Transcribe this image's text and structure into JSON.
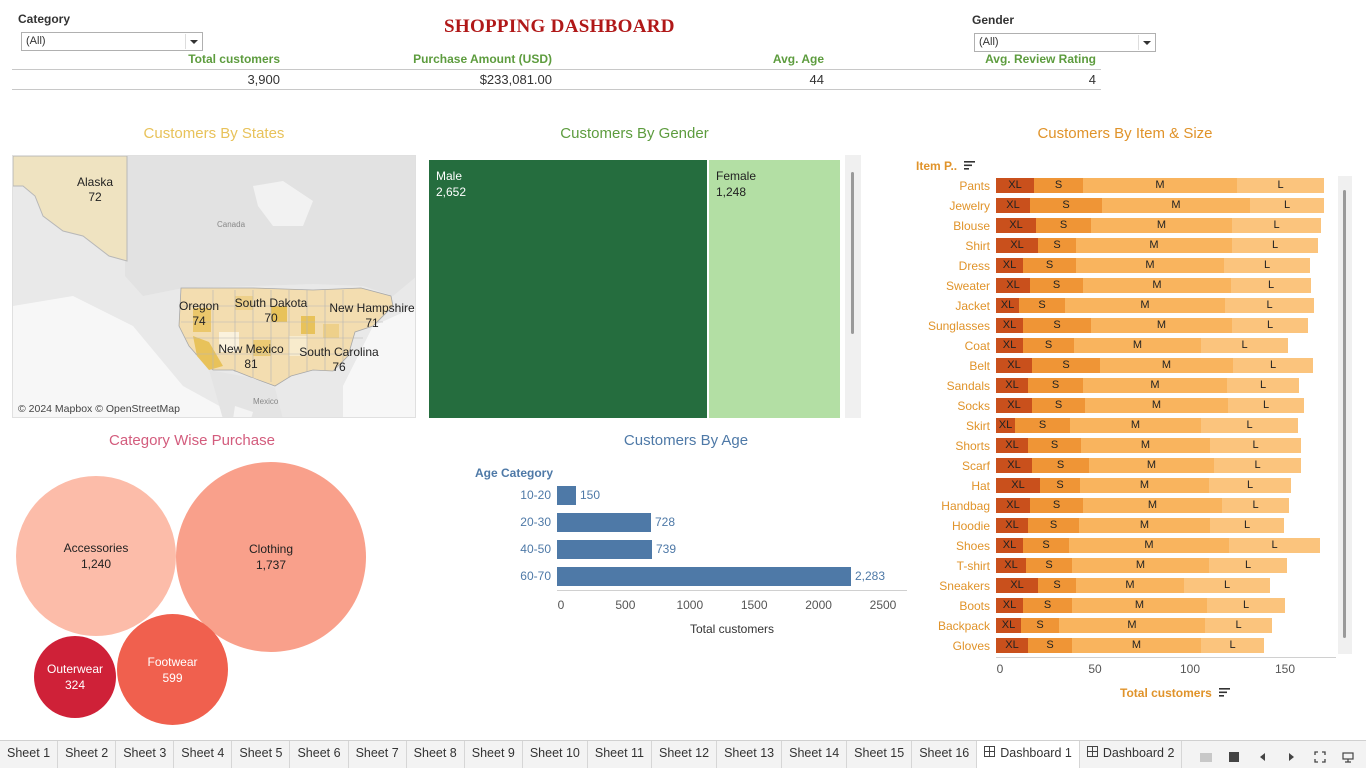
{
  "title": "SHOPPING DASHBOARD",
  "filters": {
    "category": {
      "label": "Category",
      "value": "(All)"
    },
    "gender": {
      "label": "Gender",
      "value": "(All)"
    }
  },
  "kpis": [
    {
      "label": "Total customers",
      "value": "3,900"
    },
    {
      "label": "Purchase Amount (USD)",
      "value": "$233,081.00"
    },
    {
      "label": "Avg. Age",
      "value": "44"
    },
    {
      "label": "Avg. Review Rating",
      "value": "4"
    }
  ],
  "states_map": {
    "title": "Customers By States",
    "labels": [
      {
        "state": "Alaska",
        "value": "72"
      },
      {
        "state": "Oregon",
        "value": "74"
      },
      {
        "state": "South Dakota",
        "value": "70"
      },
      {
        "state": "New Hampshire",
        "value": "71"
      },
      {
        "state": "New Mexico",
        "value": "81"
      },
      {
        "state": "South Carolina",
        "value": "76"
      }
    ],
    "place_canada": "Canada",
    "place_mexico": "Mexico",
    "attribution": "© 2024 Mapbox © OpenStreetMap"
  },
  "colors": {
    "kpi_green": "#5d9c3e",
    "title_red": "#b01818",
    "male": "#256d3e",
    "female": "#b3dfa4",
    "age_bar": "#4e79a7",
    "xl": "#c9501c",
    "s": "#ef9536",
    "m": "#f9b45e",
    "l": "#fbc47d"
  },
  "chart_data": [
    {
      "type": "treemap",
      "title": "Customers By Gender",
      "categories": [
        "Male",
        "Female"
      ],
      "values": [
        2652,
        1248
      ],
      "display": [
        "2,652",
        "1,248"
      ]
    },
    {
      "type": "bar",
      "orientation": "horizontal",
      "title": "Customers By Age",
      "ylabel": "Age Category",
      "xlabel": "Total customers",
      "categories": [
        "10-20",
        "20-30",
        "40-50",
        "60-70"
      ],
      "values": [
        150,
        728,
        739,
        2283
      ],
      "display": [
        "150",
        "728",
        "739",
        "2,283"
      ],
      "xlim": [
        0,
        2500
      ],
      "xticks": [
        "0",
        "500",
        "1000",
        "1500",
        "2000",
        "2500"
      ]
    },
    {
      "type": "bubble",
      "title": "Category Wise Purchase",
      "categories": [
        "Accessories",
        "Clothing",
        "Outerwear",
        "Footwear"
      ],
      "values": [
        1240,
        1737,
        324,
        599
      ],
      "display": [
        "1,240",
        "1,737",
        "324",
        "599"
      ]
    },
    {
      "type": "bar",
      "orientation": "horizontal",
      "stacked": true,
      "title": "Customers By Item & Size",
      "ylabel": "Item P..",
      "xlabel": "Total customers",
      "xlim": [
        0,
        170
      ],
      "xticks": [
        "0",
        "50",
        "100",
        "150"
      ],
      "segments": [
        "XL",
        "S",
        "M",
        "L"
      ],
      "categories": [
        "Pants",
        "Jewelry",
        "Blouse",
        "Shirt",
        "Dress",
        "Sweater",
        "Jacket",
        "Sunglasses",
        "Coat",
        "Belt",
        "Sandals",
        "Socks",
        "Skirt",
        "Shorts",
        "Scarf",
        "Hat",
        "Handbag",
        "Hoodie",
        "Shoes",
        "T-shirt",
        "Sneakers",
        "Boots",
        "Backpack",
        "Gloves"
      ],
      "series": [
        {
          "name": "XL",
          "values": [
            20,
            18,
            21,
            22,
            14,
            18,
            12,
            14,
            14,
            19,
            17,
            19,
            10,
            17,
            19,
            23,
            18,
            17,
            14,
            16,
            22,
            14,
            13,
            17
          ]
        },
        {
          "name": "S",
          "values": [
            26,
            38,
            29,
            20,
            28,
            28,
            24,
            36,
            27,
            36,
            29,
            28,
            29,
            28,
            30,
            21,
            28,
            27,
            24,
            24,
            20,
            26,
            20,
            23
          ]
        },
        {
          "name": "M",
          "values": [
            81,
            78,
            74,
            82,
            78,
            78,
            84,
            74,
            67,
            70,
            76,
            75,
            69,
            68,
            66,
            68,
            73,
            69,
            84,
            72,
            57,
            71,
            77,
            68
          ]
        },
        {
          "name": "L",
          "values": [
            46,
            39,
            47,
            45,
            45,
            42,
            47,
            40,
            46,
            42,
            38,
            40,
            51,
            48,
            46,
            43,
            35,
            39,
            48,
            41,
            45,
            41,
            35,
            33
          ]
        }
      ]
    }
  ],
  "tabs": [
    "Sheet 1",
    "Sheet 2",
    "Sheet 3",
    "Sheet 4",
    "Sheet 5",
    "Sheet 6",
    "Sheet 7",
    "Sheet 8",
    "Sheet 9",
    "Sheet 10",
    "Sheet 11",
    "Sheet 12",
    "Sheet 13",
    "Sheet 14",
    "Sheet 15",
    "Sheet 16",
    "Dashboard 1",
    "Dashboard 2"
  ],
  "active_tab": "Dashboard 1"
}
